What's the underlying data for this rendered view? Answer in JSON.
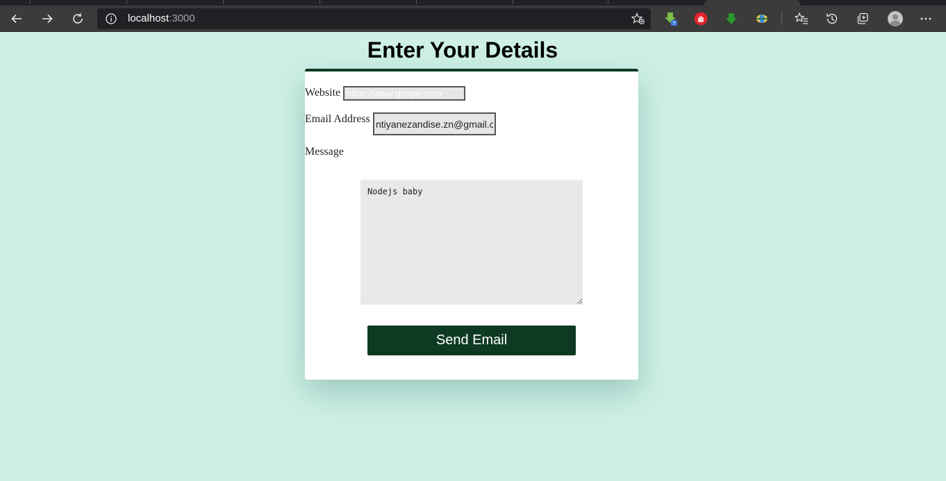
{
  "browser": {
    "url_host": "localhost",
    "url_port": ":3000"
  },
  "page": {
    "title": "Enter Your Details"
  },
  "form": {
    "website_label": "Website",
    "website_placeholder": "https://www.google.com",
    "website_value": "",
    "email_label": "Email Address",
    "email_value": "ntiyanezandise.zn@gmail.co",
    "message_label": "Message",
    "message_value": "Nodejs baby",
    "submit_label": "Send Email"
  },
  "colors": {
    "background": "#cef0e6",
    "accent": "#0e3a23",
    "card": "#ffffff"
  }
}
